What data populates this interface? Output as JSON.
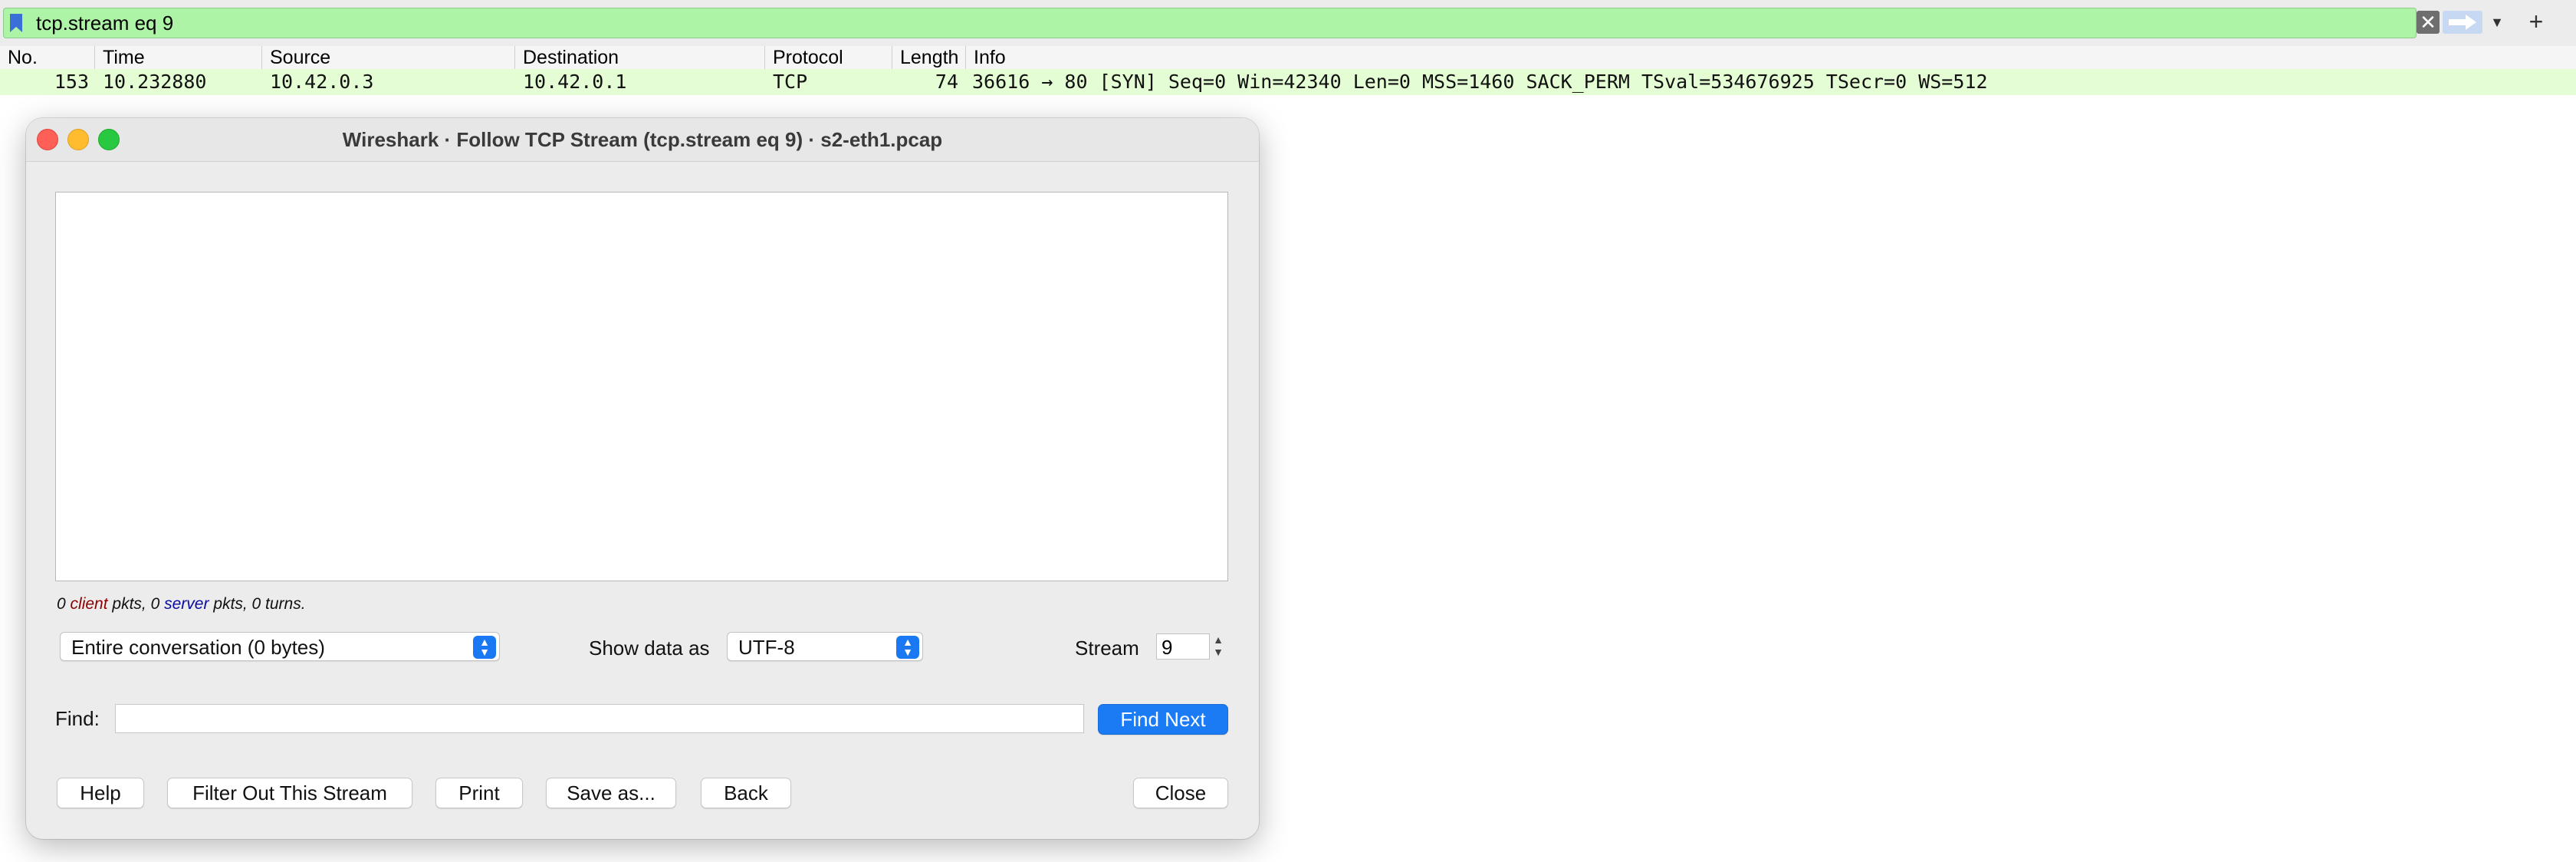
{
  "filter": {
    "value": "tcp.stream eq 9",
    "clear_icon": "clear-icon",
    "apply_icon": "arrow-right-icon",
    "history_icon": "chevron-down-icon",
    "add_label": "+"
  },
  "packet_list": {
    "columns": [
      "No.",
      "Time",
      "Source",
      "Destination",
      "Protocol",
      "Length",
      "Info"
    ],
    "rows": [
      {
        "no": "153",
        "time": "10.232880",
        "source": "10.42.0.3",
        "destination": "10.42.0.1",
        "protocol": "TCP",
        "length": "74",
        "info": "36616 → 80 [SYN] Seq=0 Win=42340 Len=0 MSS=1460 SACK_PERM TSval=534676925 TSecr=0 WS=512"
      }
    ],
    "row_color": "#e5fdd4"
  },
  "dialog": {
    "title": "Wireshark · Follow TCP Stream (tcp.stream eq 9) · s2-eth1.pcap",
    "stream_text": "",
    "stats": {
      "client_pkts": "0",
      "client_word": "client",
      "mid1": "pkts, ",
      "server_pkts": "0",
      "server_word": "server",
      "tail": "pkts, 0 turns."
    },
    "conversation_select": "Entire conversation (0 bytes)",
    "show_data_label": "Show data as",
    "show_data_select": "UTF-8",
    "stream_label": "Stream",
    "stream_value": "9",
    "find_label": "Find:",
    "find_value": "",
    "find_next_label": "Find Next",
    "buttons": {
      "help": "Help",
      "filter_out": "Filter Out This Stream",
      "print": "Print",
      "save_as": "Save as...",
      "back": "Back",
      "close": "Close"
    }
  },
  "colors": {
    "filter_valid": "#aef4a6",
    "accent": "#1a7bf5",
    "client_text": "#8b0000",
    "server_text": "#0a0aa0"
  }
}
